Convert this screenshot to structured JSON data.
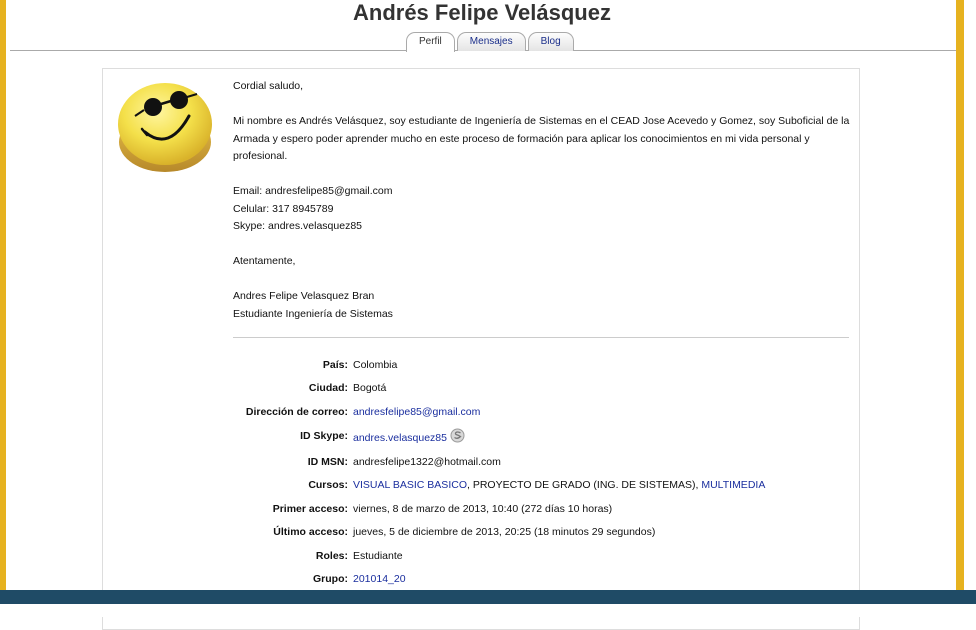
{
  "profile": {
    "name": "Andrés Felipe Velásquez"
  },
  "tabs": [
    {
      "label": "Perfil",
      "active": true
    },
    {
      "label": "Mensajes",
      "active": false
    },
    {
      "label": "Blog",
      "active": false
    }
  ],
  "description": {
    "greeting": "Cordial saludo,",
    "intro": "Mi nombre es Andrés Velásquez, soy estudiante de Ingeniería de Sistemas en el CEAD Jose Acevedo y Gomez, soy Suboficial de la Armada y espero poder aprender mucho en este proceso de formación para aplicar los conocimientos en mi vida personal y profesional.",
    "email_line": "Email: andresfelipe85@gmail.com",
    "phone_line": "Celular: 317 8945789",
    "skype_line": "Skype: andres.velasquez85",
    "closing": "Atentamente,",
    "signature_name": "Andres Felipe Velasquez Bran",
    "signature_title": "Estudiante Ingeniería de Sistemas"
  },
  "fields": {
    "country": {
      "label": "País:",
      "value": "Colombia"
    },
    "city": {
      "label": "Ciudad:",
      "value": "Bogotá"
    },
    "email": {
      "label": "Dirección de correo:",
      "value": "andresfelipe85@gmail.com"
    },
    "skype": {
      "label": "ID Skype:",
      "value": "andres.velasquez85"
    },
    "msn": {
      "label": "ID MSN:",
      "value": "andresfelipe1322@hotmail.com"
    },
    "courses": {
      "label": "Cursos:",
      "items": [
        "VISUAL BASIC BASICO",
        "PROYECTO DE GRADO (ING. DE SISTEMAS)",
        "MULTIMEDIA"
      ],
      "sep1": ", ",
      "sep2": ", "
    },
    "first_access": {
      "label": "Primer acceso:",
      "value": "viernes, 8 de marzo de 2013, 10:40  (272 días 10 horas)"
    },
    "last_access": {
      "label": "Último acceso:",
      "value": "jueves, 5 de diciembre de 2013, 20:25  (18 minutos 29 segundos)"
    },
    "roles": {
      "label": "Roles:",
      "value": "Estudiante"
    },
    "group": {
      "label": "Grupo:",
      "value": "201014_20"
    }
  },
  "colors": {
    "frame": "#e6b21f",
    "link": "#1a2e9e",
    "bottom_bar": "#1f4b66"
  },
  "icons": {
    "avatar": "smiley-sunglasses-avatar",
    "skype_status": "skype-status-icon"
  }
}
